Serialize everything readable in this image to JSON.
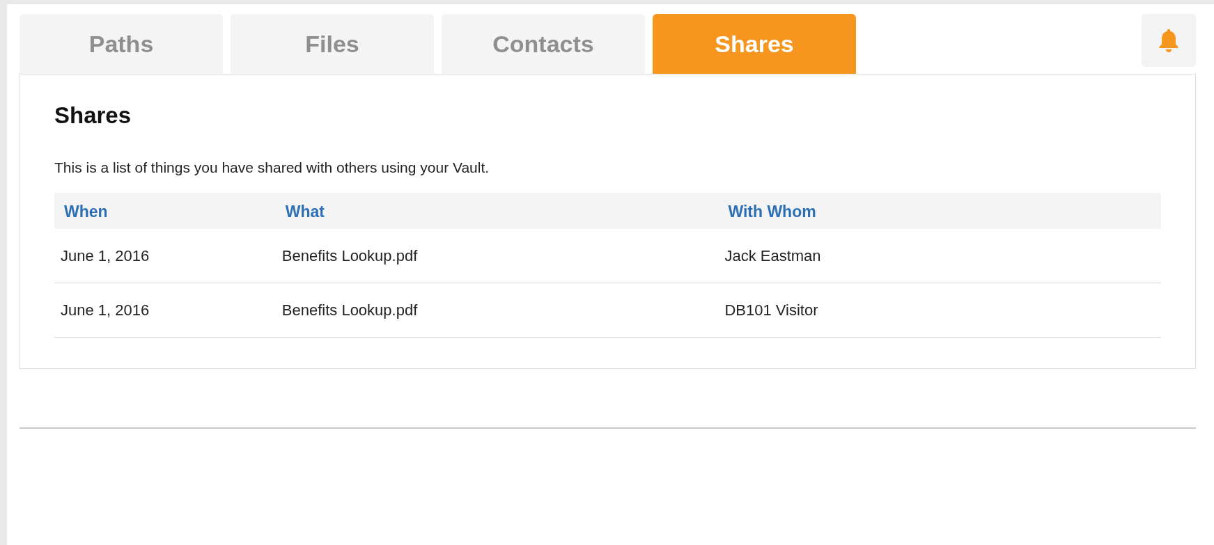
{
  "tabs": [
    {
      "label": "Paths",
      "selected": false
    },
    {
      "label": "Files",
      "selected": false
    },
    {
      "label": "Contacts",
      "selected": false
    },
    {
      "label": "Shares",
      "selected": true
    }
  ],
  "panel": {
    "title": "Shares",
    "description": "This is a list of things you have shared with others using your Vault.",
    "table": {
      "columns": [
        "When",
        "What",
        "With Whom"
      ],
      "rows": [
        [
          "June 1, 2016",
          "Benefits Lookup.pdf",
          "Jack Eastman"
        ],
        [
          "June 1, 2016",
          "Benefits Lookup.pdf",
          "DB101 Visitor"
        ]
      ]
    }
  }
}
